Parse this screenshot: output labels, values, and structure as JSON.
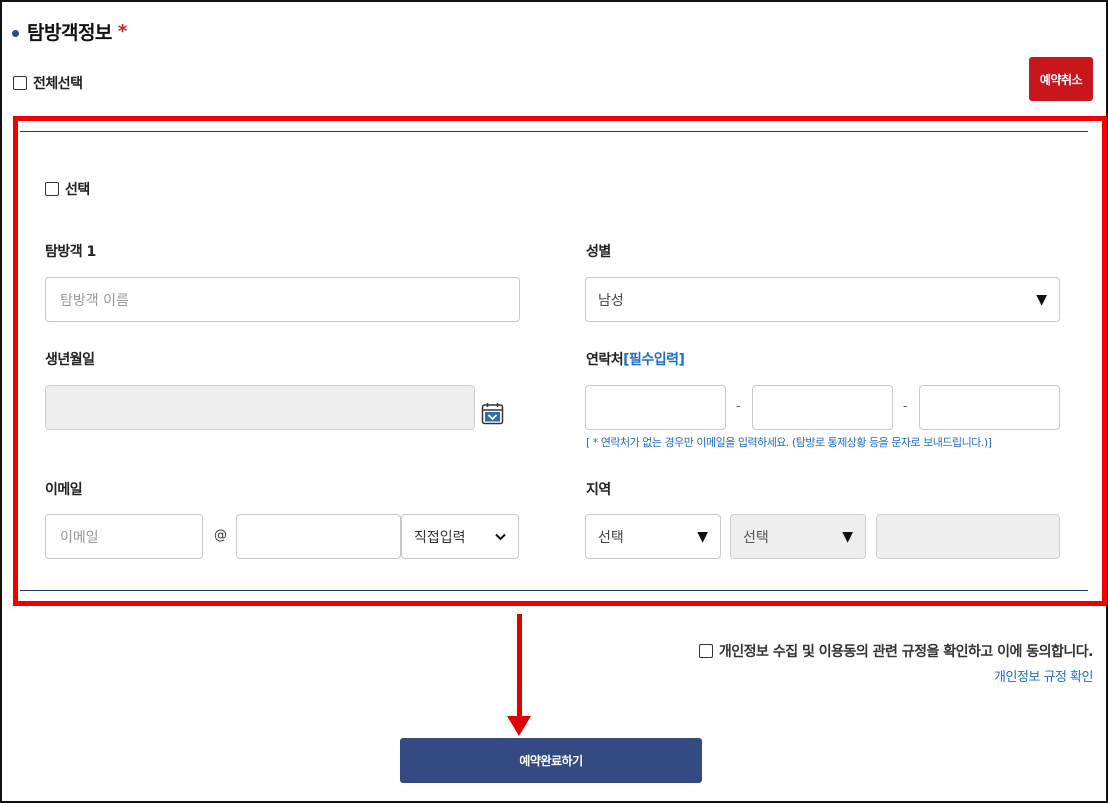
{
  "section": {
    "title": "탐방객정보",
    "required_mark": "*",
    "select_all_label": "전체선택",
    "cancel_button": "예약취소"
  },
  "visitor": {
    "select_label": "선택",
    "name_label": "탐방객 1",
    "name_placeholder": "탐방객 이름",
    "gender_label": "성별",
    "gender_value": "남성",
    "birth_label": "생년월일",
    "contact_label": "연락처",
    "contact_required": "[필수입력]",
    "phone_separator": "-",
    "contact_hint": "[ * 연락처가 없는 경우만 이메일을 입력하세요. (탐방로 통제상황 등을 문자로 보내드립니다.)]",
    "email_label": "이메일",
    "email_placeholder": "이메일",
    "email_at": "@",
    "email_domain_select": "직접입력",
    "region_label": "지역",
    "region_select_1": "선택",
    "region_select_2": "선택"
  },
  "agreement": {
    "consent_label": "개인정보 수집 및 이용동의 관련 규정을 확인하고 이에 동의합니다.",
    "policy_link": "개인정보 규정 확인"
  },
  "submit_button": "예약완료하기",
  "colors": {
    "accent_red": "#c8161d",
    "primary_navy": "#344a83",
    "link_blue": "#1e6fc4",
    "highlight_red": "#f20000"
  }
}
